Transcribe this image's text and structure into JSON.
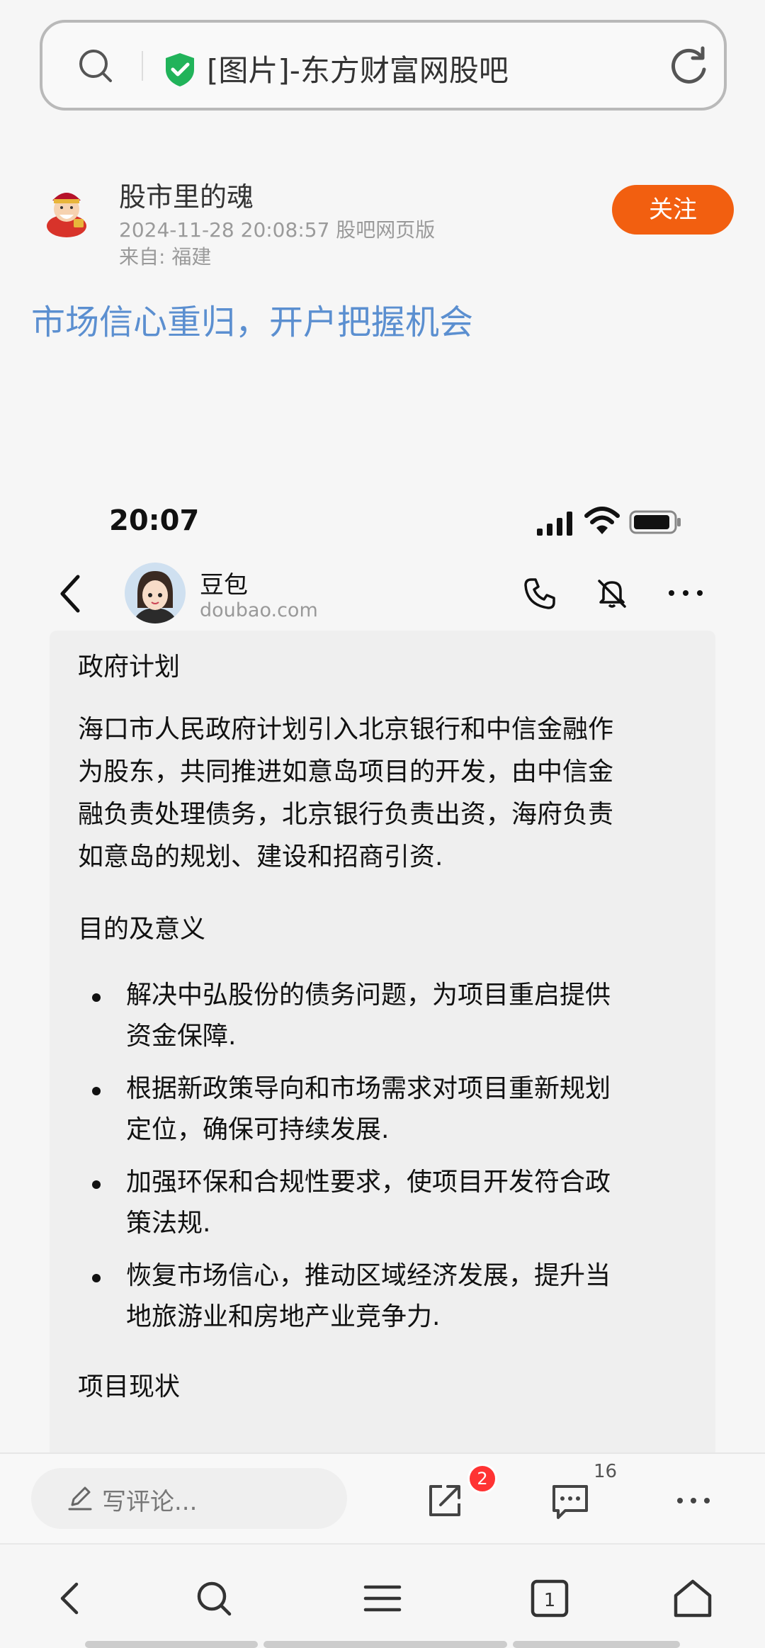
{
  "browser": {
    "address_text": "[图片]-东方财富网股吧"
  },
  "post": {
    "author": "股市里的魂",
    "meta": "2024-11-28 20:08:57 股吧网页版",
    "location": "来自: 福建",
    "follow_label": "关注",
    "title": "市场信心重归，开户把握机会"
  },
  "embedded": {
    "status_time": "20:07",
    "chat_name": "豆包",
    "chat_domain": "doubao.com",
    "sections": {
      "h1": "政府计划",
      "p1_lines": [
        "海口市人民政府计划引入北京银行和中信金融作",
        "为股东，共同推进如意岛项目的开发，由中信金",
        "融负责处理债务，北京银行负责出资，海府负责",
        "如意岛的规划、建设和招商引资."
      ],
      "h2": "目的及意义",
      "bullets": [
        [
          "解决中弘股份的债务问题，为项目重启提供",
          "资金保障."
        ],
        [
          "根据新政策导向和市场需求对项目重新规划",
          "定位，确保可持续发展."
        ],
        [
          "加强环保和合规性要求，使项目开发符合政",
          "策法规."
        ],
        [
          "恢复市场信心，推动区域经济发展，提升当",
          "地旅游业和房地产业竞争力."
        ]
      ],
      "h3": "项目现状"
    }
  },
  "comment_bar": {
    "placeholder": "写评论...",
    "share_badge": "2",
    "comment_count": "16"
  },
  "bottom_nav": {
    "tabs_count": "1"
  },
  "colors": {
    "follow_btn": "#f25f10",
    "title_link": "#5b8fd0",
    "shield": "#21b35a",
    "badge": "#ff3333"
  },
  "icons": [
    "search-icon",
    "shield-check-icon",
    "reload-icon",
    "back-icon",
    "phone-icon",
    "mute-icon",
    "more-icon",
    "pen-icon",
    "share-icon",
    "comment-icon",
    "menu-icon",
    "tabs-icon",
    "home-icon"
  ]
}
